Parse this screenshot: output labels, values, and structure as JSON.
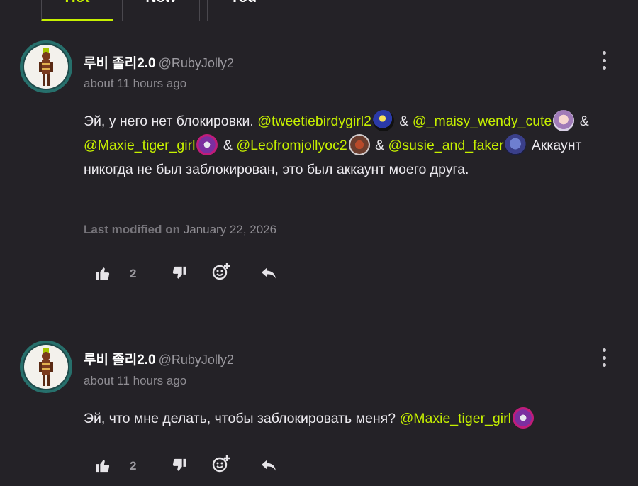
{
  "tabs": [
    {
      "label": "Hot",
      "active": true
    },
    {
      "label": "New",
      "active": false
    },
    {
      "label": "You",
      "active": false
    }
  ],
  "comments": [
    {
      "username": "루비 졸리2.0",
      "handle": "@RubyJolly2",
      "time": "about 11 hours ago",
      "body": {
        "t1": "Эй, у него нет блокировки.",
        "m1": "@tweetiebirdygirl2",
        "amp1": "&",
        "m2": "@_maisy_wendy_cute",
        "amp2": "&",
        "m3": "@Maxie_tiger_girl",
        "amp3": "&",
        "m4": "@Leofromjollyoc2",
        "amp4": "&",
        "m5": "@susie_and_faker",
        "t2": "Аккаунт никогда не был заблокирован, это был аккаунт моего друга."
      },
      "modified_label": "Last modified on",
      "modified_date": "January 22, 2026",
      "likes": "2"
    },
    {
      "username": "루비 졸리2.0",
      "handle": "@RubyJolly2",
      "time": "about 11 hours ago",
      "body": {
        "t1": "Эй, что мне делать, чтобы заблокировать меня?",
        "m1": "@Maxie_tiger_girl"
      },
      "likes": "2"
    }
  ],
  "icons": [
    "thumbs-up-icon",
    "thumbs-down-icon",
    "add-reaction-icon",
    "reply-icon",
    "more-options-icon"
  ],
  "colors": {
    "accent": "#c6f000",
    "background": "#242227",
    "muted": "#8f8d93"
  }
}
